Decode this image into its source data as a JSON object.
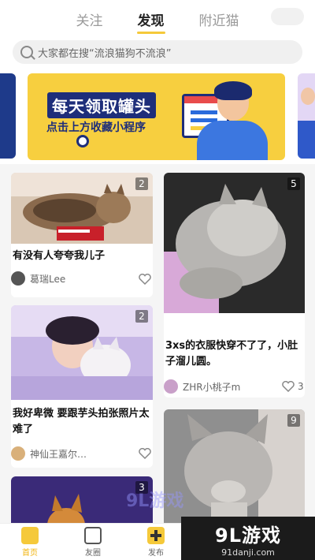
{
  "tabs": [
    {
      "label": "关注",
      "active": false
    },
    {
      "label": "发现",
      "active": true
    },
    {
      "label": "附近猫",
      "active": false
    }
  ],
  "search": {
    "placeholder": "大家都在搜“流浪猫狗不流浪”"
  },
  "banner": {
    "title": "每天领取罐头",
    "subtitle": "点击上方收藏小程序"
  },
  "posts": [
    {
      "title": "有没有人夸夸我儿子",
      "author": "葛瑞Lee",
      "photo_count": "2",
      "likes": ""
    },
    {
      "title": "3xs的衣服快穿不了了，小肚子溜儿圆。",
      "author": "ZHR小桃子m",
      "photo_count": "5",
      "likes": "3"
    },
    {
      "title": "我好卑微 要跟芋头拍张照片太难了",
      "author": "神仙王嘉尔…",
      "photo_count": "2",
      "likes": ""
    },
    {
      "title": "",
      "author": "",
      "photo_count": "9",
      "likes": ""
    },
    {
      "title": "",
      "author": "",
      "photo_count": "3",
      "likes": ""
    }
  ],
  "nav": [
    {
      "label": "首页",
      "active": true
    },
    {
      "label": "友圈",
      "active": false
    },
    {
      "label": "发布",
      "active": false
    }
  ],
  "watermark": {
    "main": "9L游戏",
    "sub": "91danji.com",
    "mid": "9L游戏"
  },
  "colors": {
    "accent": "#f5c93a",
    "banner_bg": "#f7cf3f",
    "banner_text": "#1e2e7a"
  }
}
